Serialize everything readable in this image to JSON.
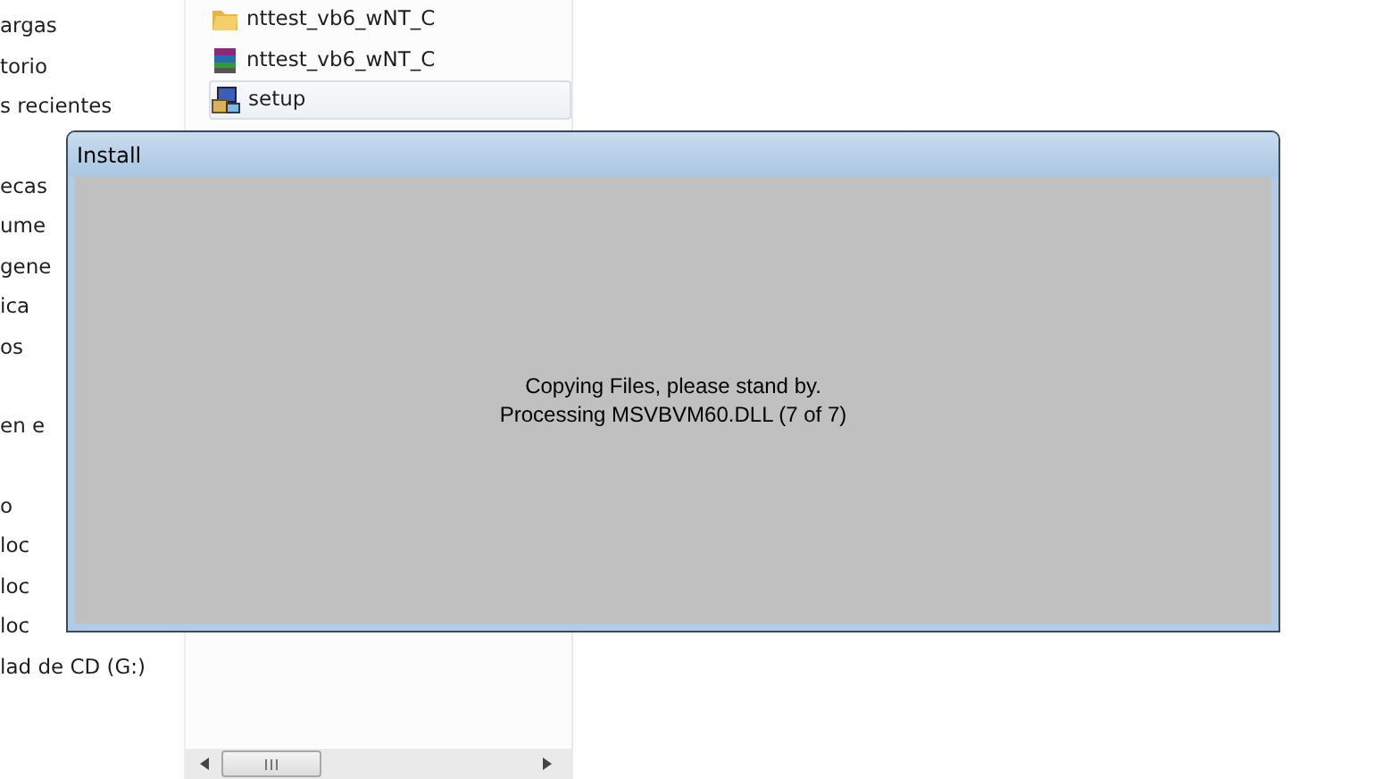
{
  "sidebar": {
    "groups": [
      {
        "items": [
          "argas",
          "torio",
          "s recientes"
        ]
      },
      {
        "items": [
          "ecas",
          "ume",
          "gene",
          "ica",
          "os"
        ]
      },
      {
        "items": [
          "en e"
        ]
      },
      {
        "items": [
          "o",
          "loc",
          "loc",
          "loc",
          "lad de CD (G:)"
        ]
      }
    ]
  },
  "files": [
    {
      "kind": "folder",
      "name": "nttest_vb6_wNT_C",
      "selected": false
    },
    {
      "kind": "archive",
      "name": "nttest_vb6_wNT_C",
      "selected": false
    },
    {
      "kind": "setup",
      "name": "setup",
      "selected": true
    }
  ],
  "dialog": {
    "title": "Install",
    "lines": [
      "Copying Files, please stand by.",
      "Processing MSVBVM60.DLL (7 of 7)"
    ]
  }
}
